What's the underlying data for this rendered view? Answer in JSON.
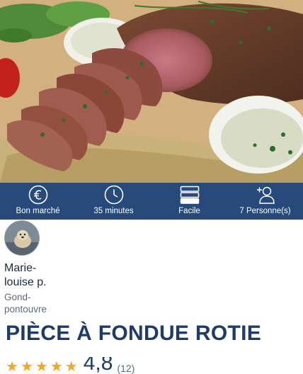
{
  "recipe": {
    "title": "PIÈCE À FONDUE ROTIE"
  },
  "info_bar": {
    "items": [
      {
        "icon": "euro-icon",
        "label": "Bon marché"
      },
      {
        "icon": "clock-icon",
        "label": "35 minutes"
      },
      {
        "icon": "difficulty-icon",
        "label": "Facile"
      },
      {
        "icon": "add-person-icon",
        "label": "7 Personne(s)"
      }
    ]
  },
  "author": {
    "name": "Marie-louise p.",
    "city": "Gond-pontouvre"
  },
  "rating": {
    "value": "4,8",
    "count": "(12)",
    "stars": 5
  },
  "colors": {
    "info_bar_bg": "#274a7a",
    "title": "#1f3b68",
    "star": "#f5a623"
  }
}
